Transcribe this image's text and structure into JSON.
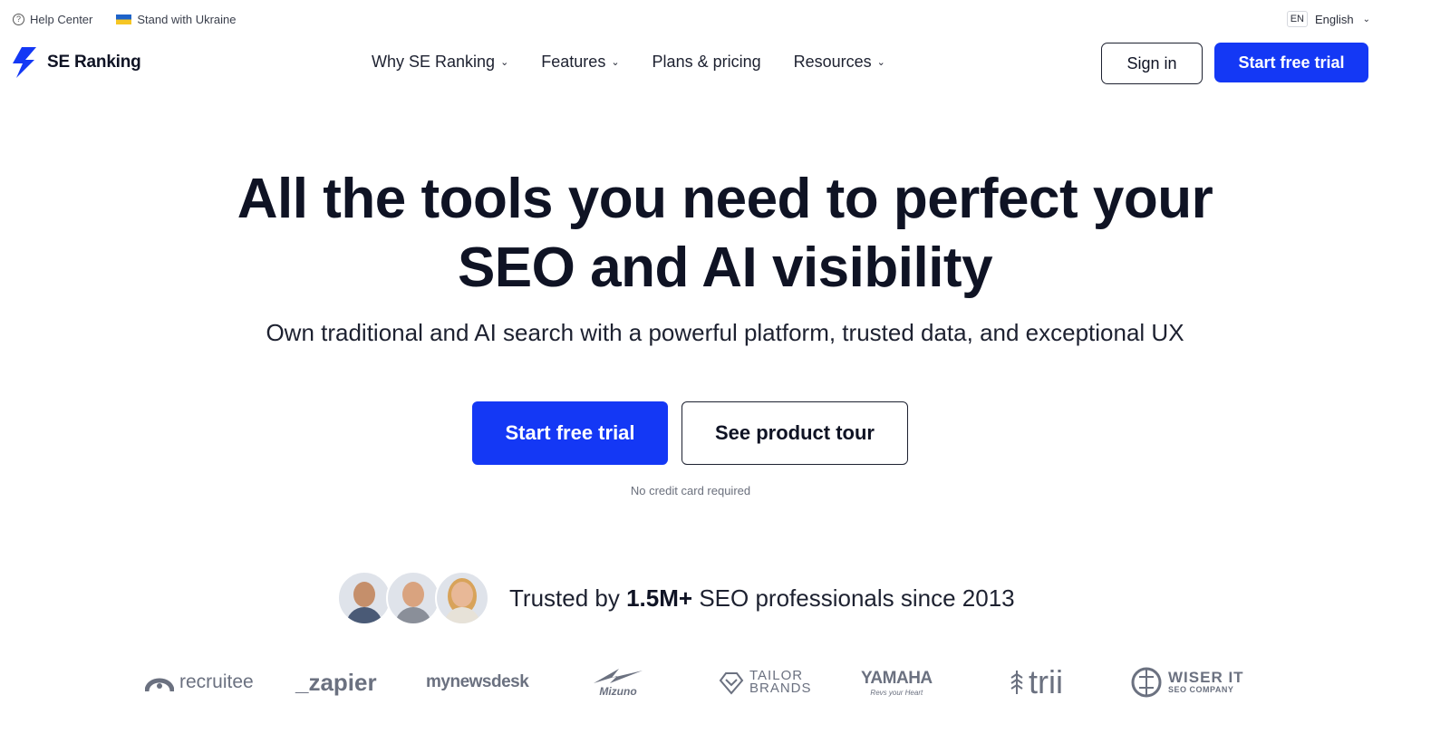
{
  "topbar": {
    "help_label": "Help Center",
    "ukraine_label": "Stand with Ukraine",
    "lang_code": "EN",
    "lang_label": "English"
  },
  "header": {
    "logo_text": "SE Ranking",
    "nav": [
      {
        "label": "Why SE Ranking",
        "has_dropdown": true
      },
      {
        "label": "Features",
        "has_dropdown": true
      },
      {
        "label": "Plans & pricing",
        "has_dropdown": false
      },
      {
        "label": "Resources",
        "has_dropdown": true
      }
    ],
    "signin_label": "Sign in",
    "trial_label": "Start free trial"
  },
  "hero": {
    "title_line1": "All the tools you need to perfect your",
    "title_line2": "SEO and AI visibility",
    "subtitle": "Own traditional and AI search with a powerful platform, trusted data, and exceptional UX",
    "trial_button": "Start free trial",
    "tour_button": "See product tour",
    "note": "No credit card required"
  },
  "trusted": {
    "prefix": "Trusted by ",
    "highlight": "1.5M+",
    "suffix": " SEO professionals since 2013"
  },
  "logos": {
    "recruitee": "recruitee",
    "zapier": "_zapier",
    "mynewsdesk": "mynewsdesk",
    "mizuno": "Mizuno",
    "tailor_line1": "TAILOR",
    "tailor_line2": "BRANDS",
    "yamaha": "YAMAHA",
    "yamaha_tag": "Revs your Heart",
    "trii": "trii",
    "wiser_line1": "WISER IT",
    "wiser_line2": "SEO COMPANY"
  },
  "colors": {
    "accent": "#1438f5",
    "text": "#0f1324",
    "logo_gray": "#6b7180"
  }
}
